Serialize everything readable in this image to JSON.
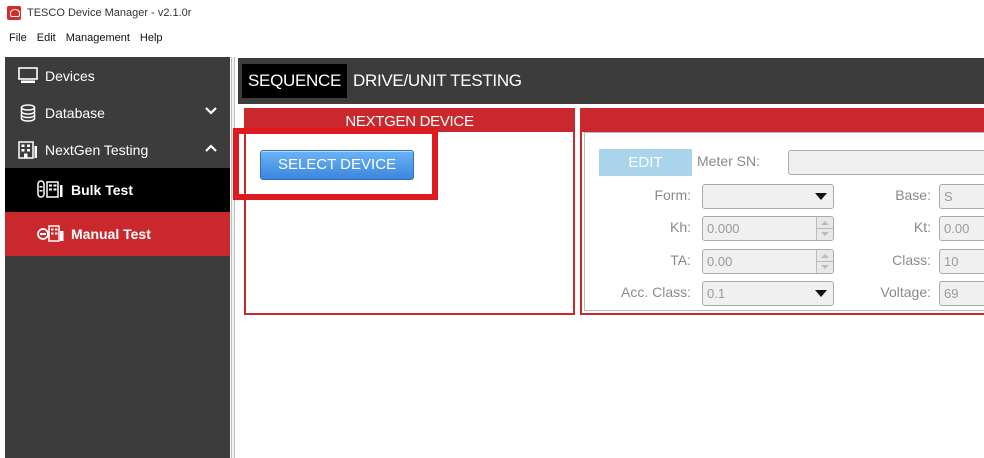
{
  "window": {
    "title": "TESCO Device Manager - v2.1.0r"
  },
  "menu": [
    "File",
    "Edit",
    "Management",
    "Help"
  ],
  "sidebar": {
    "items": [
      {
        "label": "Devices",
        "icon": "monitor-icon"
      },
      {
        "label": "Database",
        "icon": "database-icon",
        "chevron": "down"
      },
      {
        "label": "NextGen Testing",
        "icon": "building-icon",
        "chevron": "up"
      }
    ],
    "subitems": [
      {
        "label": "Bulk Test",
        "icon": "bulk-test-icon",
        "state": "normal"
      },
      {
        "label": "Manual Test",
        "icon": "manual-test-icon",
        "state": "selected"
      }
    ]
  },
  "tabs": [
    {
      "label": "SEQUENCE",
      "active": true
    },
    {
      "label": "DRIVE/UNIT TESTING",
      "active": false
    }
  ],
  "left_panel": {
    "header": "NEXTGEN DEVICE",
    "select_button": "SELECT DEVICE"
  },
  "right_panel": {
    "header": "",
    "edit_button": "EDIT",
    "fields": {
      "meter_sn": {
        "label": "Meter SN:",
        "value": ""
      },
      "form": {
        "label": "Form:",
        "value": ""
      },
      "base": {
        "label": "Base:",
        "value": "S"
      },
      "kh": {
        "label": "Kh:",
        "value": "0.000"
      },
      "kt": {
        "label": "Kt:",
        "value": "0.00"
      },
      "ta": {
        "label": "TA:",
        "value": "0.00"
      },
      "class": {
        "label": "Class:",
        "value": "10"
      },
      "acc_class": {
        "label": "Acc. Class:",
        "value": "0.1"
      },
      "voltage": {
        "label": "Voltage:",
        "value": "69"
      }
    }
  },
  "colors": {
    "accent_red": "#c9282d",
    "highlight_red": "#e0191e",
    "sidebar_bg": "#3c3c3c",
    "button_blue": "#3b86df",
    "edit_disabled": "#a9d4ec"
  }
}
